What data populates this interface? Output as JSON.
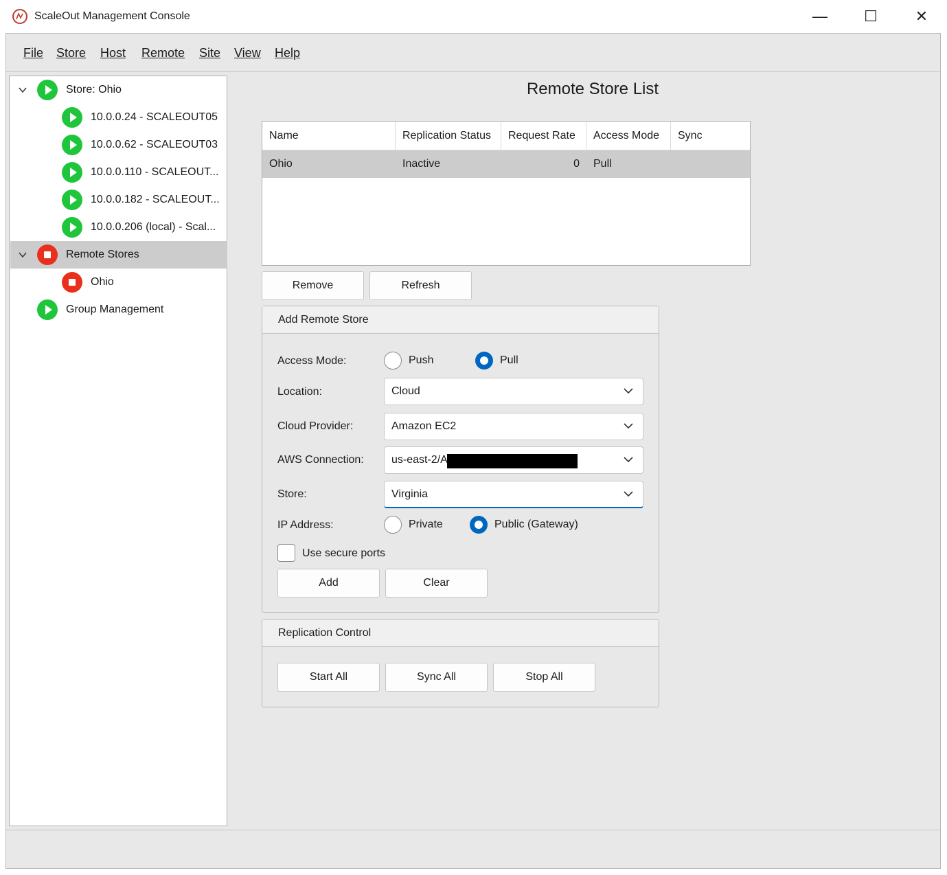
{
  "window": {
    "title": "ScaleOut Management Console",
    "minimize_icon": "—",
    "maximize_icon": "☐",
    "close_icon": "✕"
  },
  "menu": [
    "File",
    "Store",
    "Host",
    "Remote",
    "Site",
    "View",
    "Help"
  ],
  "tree": {
    "store": {
      "label": "Store: Ohio",
      "hosts": [
        "10.0.0.24 - SCALEOUT05",
        "10.0.0.62 - SCALEOUT03",
        "10.0.0.110 - SCALEOUT...",
        "10.0.0.182 - SCALEOUT...",
        "10.0.0.206 (local) - Scal..."
      ]
    },
    "remote_stores": {
      "label": "Remote Stores",
      "children": [
        "Ohio"
      ]
    },
    "group_management": "Group Management"
  },
  "main": {
    "title": "Remote Store List",
    "table": {
      "columns": [
        "Name",
        "Replication Status",
        "Request Rate",
        "Access Mode",
        "Sync"
      ],
      "rows": [
        {
          "name": "Ohio",
          "replication_status": "Inactive",
          "request_rate": "0",
          "access_mode": "Pull",
          "sync": ""
        }
      ]
    },
    "buttons": {
      "remove": "Remove",
      "refresh": "Refresh"
    },
    "add_remote_store": {
      "title": "Add Remote Store",
      "access_mode_label": "Access Mode:",
      "access_mode_options": [
        "Push",
        "Pull"
      ],
      "access_mode_selected": "Pull",
      "location_label": "Location:",
      "location_value": "Cloud",
      "cloud_provider_label": "Cloud Provider:",
      "cloud_provider_value": "Amazon EC2",
      "aws_connection_label": "AWS Connection:",
      "aws_connection_value": "us-east-2/A",
      "store_label": "Store:",
      "store_value": "Virginia",
      "ip_address_label": "IP Address:",
      "ip_address_options": [
        "Private",
        "Public (Gateway)"
      ],
      "ip_address_selected": "Public (Gateway)",
      "secure_ports_label": "Use secure ports",
      "secure_ports_checked": false,
      "add_button": "Add",
      "clear_button": "Clear"
    },
    "replication_control": {
      "title": "Replication Control",
      "start_all": "Start All",
      "sync_all": "Sync All",
      "stop_all": "Stop All"
    }
  },
  "colors": {
    "running": "#1fc63c",
    "stopped": "#e9301c",
    "accent": "#0067c0",
    "selection": "#cccccc"
  }
}
